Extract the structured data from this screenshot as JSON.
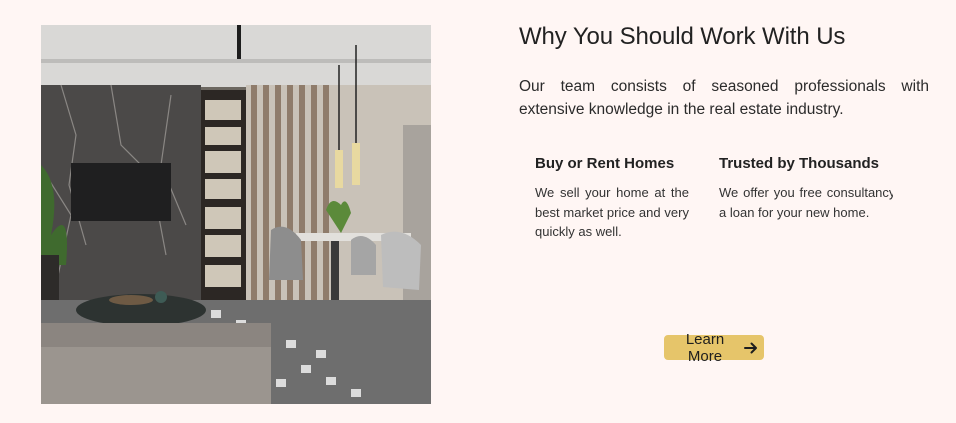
{
  "section": {
    "title": "Why You Should Work With Us",
    "intro": "Our team consists of seasoned professionals with extensive knowledge in the real estate industry."
  },
  "features": [
    {
      "title": "Buy or Rent Homes",
      "text": "We sell your home at the best market price and very quickly as well."
    },
    {
      "title": "Trusted by Thousands",
      "text": "We offer you free consultancy to get a loan for your new home."
    }
  ],
  "cta": {
    "label": "Learn More",
    "icon": "arrow-right-icon",
    "color": "#e6c56a"
  },
  "colors": {
    "background": "#fff6f4",
    "text": "#222222"
  }
}
